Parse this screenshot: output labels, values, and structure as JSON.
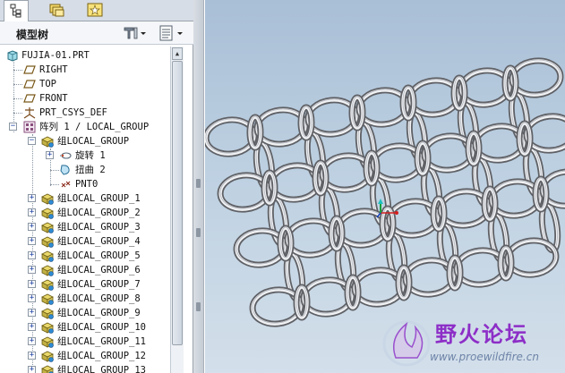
{
  "tabs": [
    {
      "name": "model-tree",
      "icon": "tree-icon"
    },
    {
      "name": "folder-browser",
      "icon": "folders-icon"
    },
    {
      "name": "favorites",
      "icon": "star-icon"
    }
  ],
  "tree_header": {
    "title": "模型树",
    "settings_icon": "tools-icon",
    "show_icon": "list-icon"
  },
  "tree": {
    "root": {
      "label": "FUJIA-01.PRT",
      "icon": "part-icon"
    },
    "datums": [
      {
        "label": "RIGHT",
        "icon": "datum-plane-icon"
      },
      {
        "label": "TOP",
        "icon": "datum-plane-icon"
      },
      {
        "label": "FRONT",
        "icon": "datum-plane-icon"
      },
      {
        "label": "PRT_CSYS_DEF",
        "icon": "csys-icon"
      }
    ],
    "pattern": {
      "label": "阵列 1 / LOCAL_GROUP",
      "icon": "pattern-icon"
    },
    "first_group": {
      "label": "组LOCAL_GROUP",
      "icon": "group-icon"
    },
    "group_children": [
      {
        "label": "旋转 1",
        "icon": "revolve-icon"
      },
      {
        "label": "扭曲 2",
        "icon": "warp-icon"
      },
      {
        "label": "PNT0",
        "icon": "datum-point-icon"
      }
    ],
    "groups": [
      "组LOCAL_GROUP_1",
      "组LOCAL_GROUP_2",
      "组LOCAL_GROUP_3",
      "组LOCAL_GROUP_4",
      "组LOCAL_GROUP_5",
      "组LOCAL_GROUP_6",
      "组LOCAL_GROUP_7",
      "组LOCAL_GROUP_8",
      "组LOCAL_GROUP_9",
      "组LOCAL_GROUP_10",
      "组LOCAL_GROUP_11",
      "组LOCAL_GROUP_12",
      "组LOCAL_GROUP_13"
    ]
  },
  "watermark": {
    "title": "野火论坛",
    "url": "www.proewildfire.cn"
  },
  "colors": {
    "viewport_top": "#a9bfd6",
    "viewport_bottom": "#d3dfea",
    "ring_stroke": "#5f6166",
    "ring_highlight": "#f1f2f4",
    "watermark": "#8d2ec7"
  }
}
